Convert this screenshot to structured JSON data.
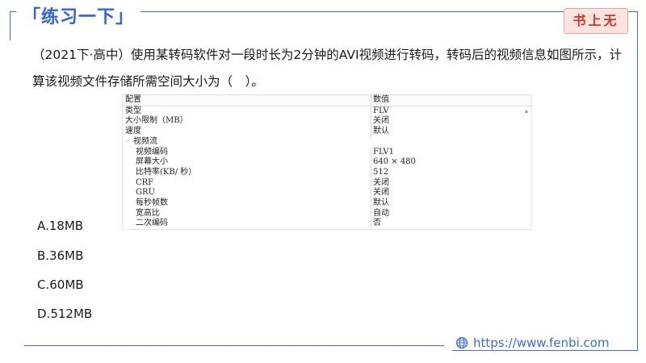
{
  "header": {
    "title": "「练习一下」",
    "brand": "书上无"
  },
  "question": {
    "text": "（2021下·高中）使用某转码软件对一段时长为2分钟的AVI视频进行转码，转码后的视频信息如图所示，计算该视频文件存储所需空间大小为（　）。"
  },
  "table": {
    "header": {
      "key": "配置",
      "value": "数值"
    },
    "rows": [
      {
        "key": "类型",
        "value": "FLV",
        "indent": 0
      },
      {
        "key": "大小限制（MB）",
        "value": "关闭",
        "indent": 0
      },
      {
        "key": "速度",
        "value": "默认",
        "indent": 0
      },
      {
        "key": "视频流",
        "value": "",
        "indent": 1
      },
      {
        "key": "视频编码",
        "value": "FLV1",
        "indent": 2
      },
      {
        "key": "屏幕大小",
        "value": "640 × 480",
        "indent": 2
      },
      {
        "key": "比特率(KB/ 秒）",
        "value": "512",
        "indent": 2
      },
      {
        "key": "CRF",
        "value": "关闭",
        "indent": 2
      },
      {
        "key": "GRU",
        "value": "关闭",
        "indent": 2
      },
      {
        "key": "每秒帧数",
        "value": "默认",
        "indent": 2
      },
      {
        "key": "宽高比",
        "value": "自动",
        "indent": 2
      },
      {
        "key": "二次编码",
        "value": "否",
        "indent": 2
      }
    ]
  },
  "options": [
    {
      "label": "A.18MB"
    },
    {
      "label": "B.36MB"
    },
    {
      "label": "C.60MB"
    },
    {
      "label": "D.512MB"
    }
  ],
  "footer": {
    "url": "https://www.fenbi.com",
    "icon": "globe-icon"
  }
}
